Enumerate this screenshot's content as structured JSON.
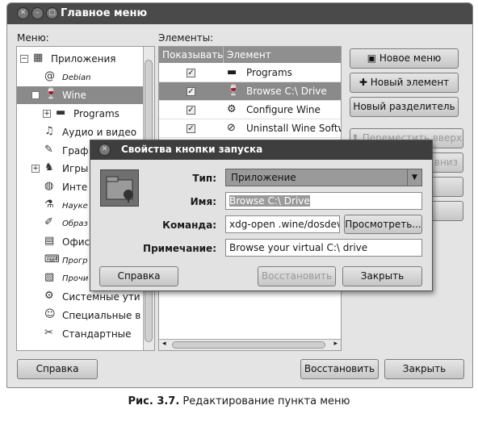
{
  "window": {
    "title": "Главное меню",
    "menu_label": "Меню:",
    "items_label": "Элементы:"
  },
  "tree": [
    {
      "label": "Приложения",
      "expander": "−",
      "icon": "applications-icon"
    },
    {
      "label": "Debian",
      "icon": "debian-swirl-icon",
      "style": "small"
    },
    {
      "label": "Wine",
      "expander": "−",
      "icon": "wine-icon",
      "selected": true
    },
    {
      "label": "Programs",
      "expander": "+",
      "icon": "folder-icon"
    },
    {
      "label": "Аудио и видео",
      "icon": "multimedia-icon"
    },
    {
      "label": "Граф",
      "icon": "graphics-icon"
    },
    {
      "label": "Игры",
      "expander": "+",
      "icon": "games-icon"
    },
    {
      "label": "Инте",
      "icon": "internet-icon"
    },
    {
      "label": "Науке",
      "icon": "science-icon",
      "style": "small"
    },
    {
      "label": "Образ",
      "icon": "education-icon",
      "style": "small"
    },
    {
      "label": "Офис",
      "icon": "office-icon"
    },
    {
      "label": "Прогр",
      "icon": "programming-icon",
      "style": "small"
    },
    {
      "label": "Прочи",
      "icon": "other-icon",
      "style": "small"
    },
    {
      "label": "Системные ути",
      "icon": "system-tools-icon"
    },
    {
      "label": "Специальные в",
      "icon": "accessibility-icon"
    },
    {
      "label": "Стандартные",
      "icon": "accessories-icon"
    }
  ],
  "table": {
    "col_show": "Показывать",
    "col_item": "Элемент",
    "rows": [
      {
        "label": "Programs",
        "checked": true,
        "icon": "folder-icon"
      },
      {
        "label": "Browse C:\\ Drive",
        "checked": true,
        "icon": "wine-glass-icon",
        "selected": true
      },
      {
        "label": "Configure Wine",
        "checked": true,
        "icon": "configure-wine-icon"
      },
      {
        "label": "Uninstall Wine Softw",
        "checked": true,
        "icon": "uninstall-icon"
      }
    ]
  },
  "side_buttons": {
    "new_menu": "Новое меню",
    "new_item": "Новый элемент",
    "new_separator": "Новый разделитель",
    "move_up": "Переместить вверх",
    "move_down_partial": "вниз"
  },
  "bottom_buttons": {
    "help": "Справка",
    "restore": "Восстановить",
    "close": "Закрыть"
  },
  "dialog": {
    "title": "Свойства кнопки запуска",
    "type_label": "Тип:",
    "type_value": "Приложение",
    "name_label": "Имя:",
    "name_value": "Browse C:\\ Drive",
    "command_label": "Команда:",
    "command_value": "xdg-open .wine/dosdev",
    "browse_button": "Просмотреть...",
    "comment_label": "Примечание:",
    "comment_value": "Browse your virtual C:\\ drive",
    "help_button": "Справка",
    "restore_button": "Восстановить",
    "close_button": "Закрыть"
  },
  "caption": {
    "prefix": "Рис. 3.7.",
    "text": " Редактирование пункта меню"
  }
}
